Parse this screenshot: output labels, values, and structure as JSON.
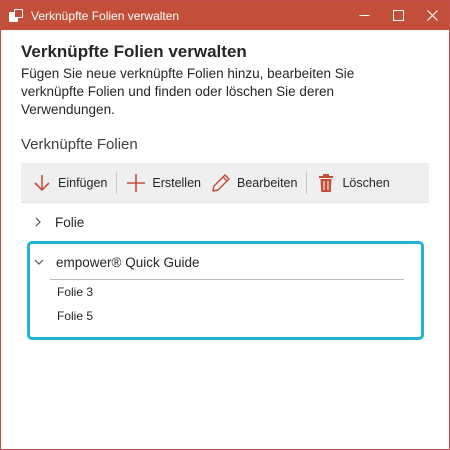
{
  "window": {
    "title": "Verknüpfte Folien verwalten"
  },
  "header": {
    "heading": "Verknüpfte Folien verwalten",
    "description": "Fügen Sie neue verknüpfte Folien hinzu, bearbeiten Sie verknüpfte Folien und finden oder löschen Sie deren Verwendungen."
  },
  "section": {
    "label": "Verknüpfte Folien"
  },
  "toolbar": {
    "insert_label": "Einfügen",
    "create_label": "Erstellen",
    "edit_label": "Bearbeiten",
    "delete_label": "Löschen"
  },
  "tree": {
    "items": [
      {
        "label": "Folie",
        "expanded": false
      },
      {
        "label": "empower® Quick Guide",
        "expanded": true,
        "children": [
          "Folie 3",
          "Folie 5"
        ]
      }
    ]
  },
  "colors": {
    "titlebar": "#c34f3b",
    "accent_icon": "#c34f3b",
    "highlight_border": "#1eb4d9",
    "toolbar_bg": "#efefef"
  },
  "icons": {
    "app": "linked-slides-icon",
    "minimize": "minimize-icon",
    "maximize": "maximize-icon",
    "close": "close-icon",
    "insert": "arrow-down-icon",
    "create": "plus-icon",
    "edit": "pencil-icon",
    "delete": "trash-icon"
  }
}
